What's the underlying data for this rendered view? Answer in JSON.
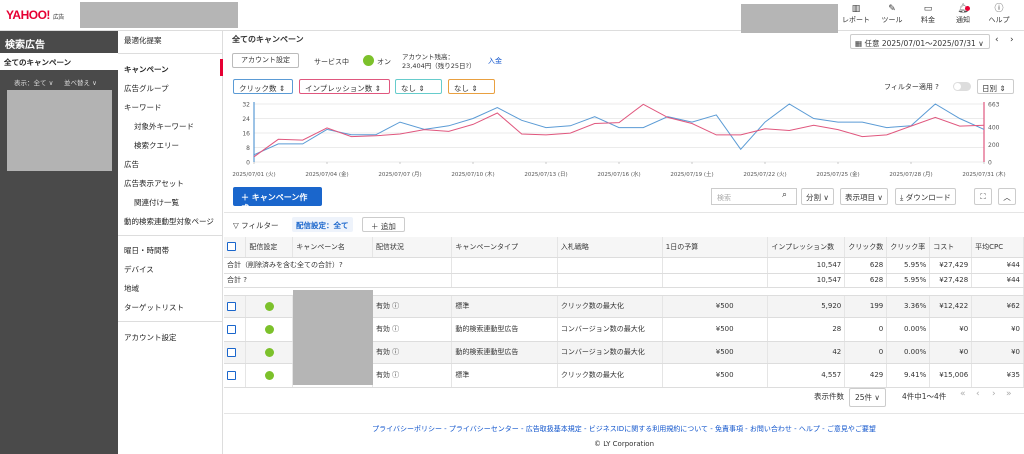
{
  "header": {
    "logo_text": "YAHOO!",
    "logo_sub": "JAPAN",
    "logo_suffix": "広告",
    "icons": [
      {
        "name": "report-icon",
        "label": "レポート",
        "glyph": "📊"
      },
      {
        "name": "tool-icon",
        "label": "ツール",
        "glyph": "🔧"
      },
      {
        "name": "billing-icon",
        "label": "料金",
        "glyph": "💳"
      },
      {
        "name": "notification-icon",
        "label": "通知",
        "glyph": "🔔"
      },
      {
        "name": "help-icon",
        "label": "ヘルプ",
        "glyph": "?"
      }
    ]
  },
  "sidebar": {
    "title": "検索広告",
    "all_campaigns": "全てのキャンペーン",
    "display_select": "表示：全て ∨",
    "sort_select": "並べ替え ∨"
  },
  "nav": {
    "items": [
      "最適化提案",
      "キャンペーン",
      "広告グループ",
      "キーワード",
      "対象外キーワード",
      "検索クエリー",
      "広告",
      "広告表示アセット",
      "関連付け一覧",
      "動的検索連動型対象ページ",
      "曜日・時間帯",
      "デバイス",
      "地域",
      "ターゲットリスト",
      "アカウント設定"
    ]
  },
  "main": {
    "title": "全てのキャンペーン",
    "account_settings": "アカウント設定",
    "service_label": "サービス中",
    "service_status": "オン",
    "balance_label": "アカウント残高：",
    "balance_value": "23,404円（残り25日?）",
    "deposit": "入金",
    "date_range": "任意 2025/07/01〜2025/07/31 ∨",
    "prev": "‹",
    "next": "›"
  },
  "chart_controls": {
    "metric1": "クリック数 ⇕",
    "metric2": "インプレッション数 ⇕",
    "metric3": "なし ⇕",
    "metric4": "なし ⇕",
    "filter_apply": "フィルター適用 ?",
    "granularity": "日別 ⇕"
  },
  "chart_data": {
    "type": "line",
    "x": [
      "2025/07/01",
      "2025/07/02",
      "2025/07/03",
      "2025/07/04",
      "2025/07/05",
      "2025/07/06",
      "2025/07/07",
      "2025/07/08",
      "2025/07/09",
      "2025/07/10",
      "2025/07/11",
      "2025/07/12",
      "2025/07/13",
      "2025/07/14",
      "2025/07/15",
      "2025/07/16",
      "2025/07/17",
      "2025/07/18",
      "2025/07/19",
      "2025/07/20",
      "2025/07/21",
      "2025/07/22",
      "2025/07/23",
      "2025/07/24",
      "2025/07/25",
      "2025/07/26",
      "2025/07/27",
      "2025/07/28",
      "2025/07/29",
      "2025/07/30",
      "2025/07/31"
    ],
    "x_tick_labels": [
      "2025/07/01 (火)",
      "2025/07/04 (金)",
      "2025/07/07 (月)",
      "2025/07/10 (木)",
      "2025/07/13 (日)",
      "2025/07/16 (水)",
      "2025/07/19 (土)",
      "2025/07/22 (火)",
      "2025/07/25 (金)",
      "2025/07/28 (月)",
      "2025/07/31 (木)"
    ],
    "series": [
      {
        "name": "クリック数",
        "axis": "left",
        "color": "#5b9bd5",
        "values": [
          4,
          10,
          10,
          18,
          15,
          15,
          22,
          18,
          20,
          24,
          30,
          23,
          19,
          20,
          25,
          19,
          19,
          25,
          22,
          26,
          7,
          22,
          32,
          24,
          22,
          22,
          19,
          20,
          32,
          24,
          18
        ]
      },
      {
        "name": "インプレッション数",
        "axis": "right",
        "color": "#e0577e",
        "values": [
          60,
          260,
          250,
          390,
          290,
          300,
          320,
          370,
          350,
          430,
          560,
          320,
          310,
          330,
          440,
          450,
          660,
          510,
          440,
          310,
          310,
          380,
          360,
          420,
          370,
          290,
          310,
          410,
          510,
          410,
          420
        ]
      }
    ],
    "y_left_ticks": [
      0,
      8,
      16,
      24,
      32
    ],
    "y_right_ticks": [
      0,
      200,
      400,
      663
    ],
    "ylim_left": [
      0,
      32
    ],
    "ylim_right": [
      0,
      663
    ]
  },
  "toolbar": {
    "create_campaign": "＋ キャンペーン作成",
    "search_placeholder": "検索",
    "split": "分割 ∨",
    "display_items": "表示項目 ∨",
    "download": "⤓ ダウンロード"
  },
  "filters": {
    "label": "▽ フィルター",
    "chip": "配信設定：全て",
    "add": "＋ 追加"
  },
  "table": {
    "headers": [
      "配信設定",
      "キャンペーン名",
      "配信状況",
      "キャンペーンタイプ",
      "入札戦略",
      "1日の予算",
      "インプレッション数",
      "クリック数",
      "クリック率",
      "コスト",
      "平均CPC"
    ],
    "total_deleted_label": "合計（削除済みを含む全ての合計）?",
    "total_label": "合計 ?",
    "total_deleted": {
      "impressions": "10,547",
      "clicks": "628",
      "ctr": "5.95%",
      "cost": "¥27,429",
      "cpc": "¥44"
    },
    "total": {
      "impressions": "10,547",
      "clicks": "628",
      "ctr": "5.95%",
      "cost": "¥27,428",
      "cpc": "¥44"
    },
    "rows": [
      {
        "status": "有効 ⓘ",
        "type": "標準",
        "bid": "クリック数の最大化",
        "budget": "¥500",
        "impressions": "5,920",
        "clicks": "199",
        "ctr": "3.36%",
        "cost": "¥12,422",
        "cpc": "¥62"
      },
      {
        "status": "有効 ⓘ",
        "type": "動的検索連動型広告",
        "bid": "コンバージョン数の最大化",
        "budget": "¥500",
        "impressions": "28",
        "clicks": "0",
        "ctr": "0.00%",
        "cost": "¥0",
        "cpc": "¥0"
      },
      {
        "status": "有効 ⓘ",
        "type": "動的検索連動型広告",
        "bid": "コンバージョン数の最大化",
        "budget": "¥500",
        "impressions": "42",
        "clicks": "0",
        "ctr": "0.00%",
        "cost": "¥0",
        "cpc": "¥0"
      },
      {
        "status": "有効 ⓘ",
        "type": "標準",
        "bid": "クリック数の最大化",
        "budget": "¥500",
        "impressions": "4,557",
        "clicks": "429",
        "ctr": "9.41%",
        "cost": "¥15,006",
        "cpc": "¥35"
      }
    ]
  },
  "pager": {
    "label": "表示件数",
    "per_page": "25件 ∨",
    "range": "4件中1〜4件",
    "first": "«",
    "prev": "‹",
    "next": "›",
    "last": "»"
  },
  "footer": {
    "links": "プライバシーポリシー - プライバシーセンター - 広告取扱基本規定 - ビジネスIDに関する利用規約について - 免責事項 - お問い合わせ - ヘルプ - ご意見やご要望",
    "copyright": "© LY Corporation"
  }
}
